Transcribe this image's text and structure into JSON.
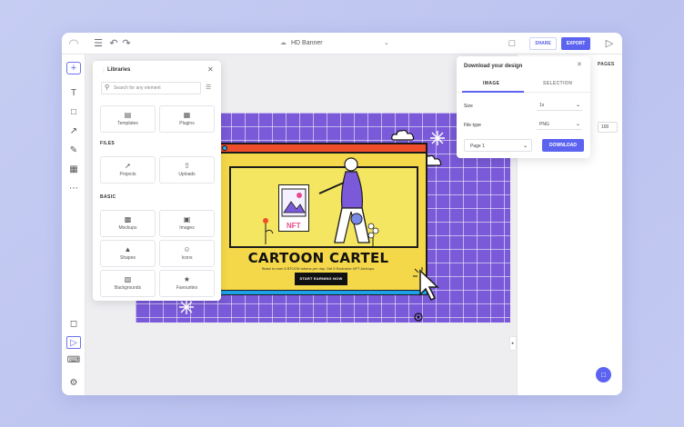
{
  "topbar": {
    "document_title": "HD Banner",
    "share_label": "SHARE",
    "export_label": "EXPORT"
  },
  "libraries": {
    "title": "Libraries",
    "search_placeholder": "Search for any element",
    "top_items": [
      {
        "label": "Templates",
        "icon": "template-icon"
      },
      {
        "label": "Plugins",
        "icon": "plugin-icon"
      }
    ],
    "files_heading": "FILES",
    "files_items": [
      {
        "label": "Projects",
        "icon": "rocket-icon"
      },
      {
        "label": "Uploads",
        "icon": "upload-icon"
      }
    ],
    "basic_heading": "BASIC",
    "basic_items": [
      {
        "label": "Mockups",
        "icon": "mockup-icon"
      },
      {
        "label": "Images",
        "icon": "image-icon"
      },
      {
        "label": "Shapes",
        "icon": "shapes-icon"
      },
      {
        "label": "Icons",
        "icon": "smiley-icon"
      },
      {
        "label": "Backgrounds",
        "icon": "backgrounds-icon"
      },
      {
        "label": "Favourites",
        "icon": "favourites-icon"
      }
    ]
  },
  "design": {
    "headline": "CARTOON CARTEL",
    "subline": "Stake to earn 5 $TOON tokens per day. Get 5 Exclusive NFT Airdrops.",
    "cta": "START EARNING NOW",
    "nft_label": "NFT",
    "background_color": "#7a5ad8",
    "accent_red": "#f04e2a",
    "accent_yellow": "#f5d84a",
    "accent_blue": "#1ea0e8"
  },
  "download_dialog": {
    "title": "Download your design",
    "tabs": [
      "IMAGE",
      "SELECTION"
    ],
    "active_tab": "IMAGE",
    "size_label": "Size",
    "size_value": "1x",
    "filetype_label": "File type",
    "filetype_value": "PNG",
    "page_value": "Page 1",
    "download_label": "DOWNLOAD"
  },
  "right_panel": {
    "pages_label": "PAGES",
    "field_value": "100"
  },
  "colors": {
    "accent": "#5b63f0",
    "page_background": "#c6cdf3"
  }
}
